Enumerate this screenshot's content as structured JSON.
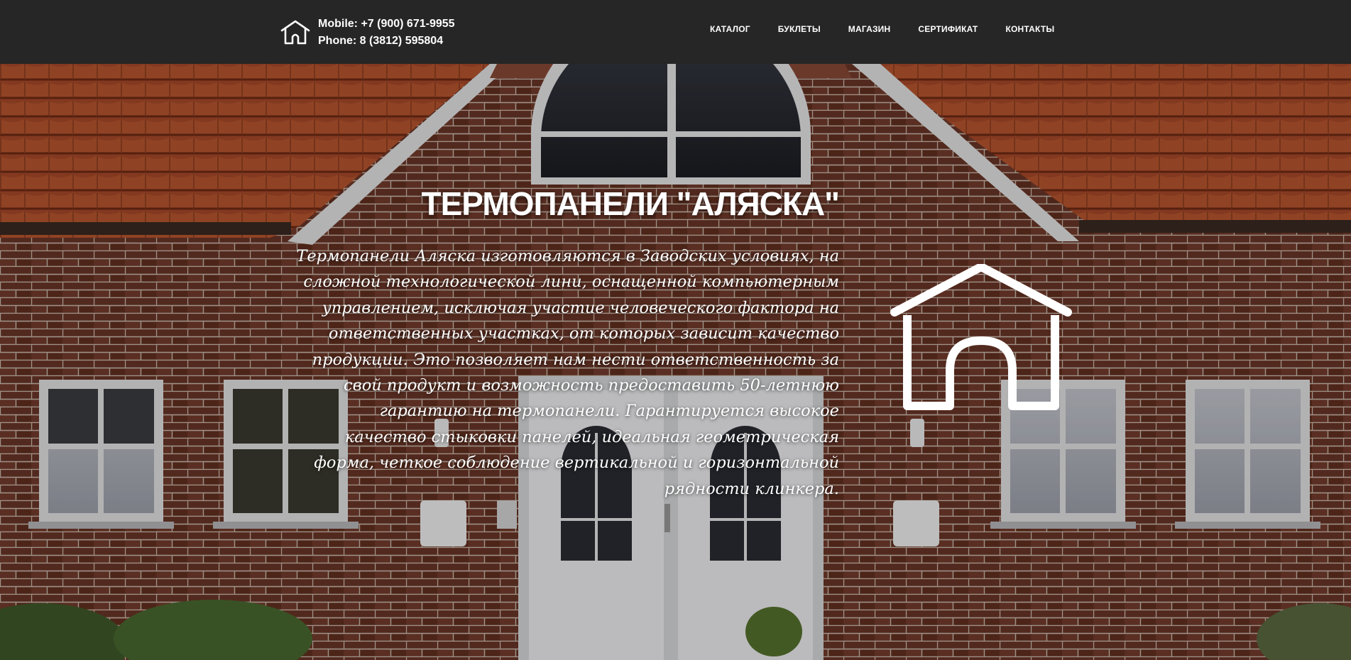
{
  "header": {
    "logo_icon": "house-outline-icon",
    "mobile": "Mobile: +7 (900) 671-9955",
    "phone": "Phone: 8 (3812) 595804"
  },
  "nav": {
    "items": [
      {
        "label": "КАТАЛОГ"
      },
      {
        "label": "БУКЛЕТЫ"
      },
      {
        "label": "МАГАЗИН"
      },
      {
        "label": "СЕРТИФИКАТ"
      },
      {
        "label": "КОНТАКТЫ"
      }
    ]
  },
  "hero": {
    "title": "ТЕРМОПАНЕЛИ \"АЛЯСКА\"",
    "description": "Термопанели Аляска изготовляются в Заводских условиях, на сложной технологической лини, оснащенной компьютерным управлением, исключая участие человеческого фактора на ответственных участках, от которых зависит качество продукции. Это позволяет нам нести ответственность за свой продукт и возможность предоставить 50-летнюю гарантию на термопанели. Гарантируется высокое качество стыковки панелей, идеальная геометрическая форма, четкое соблюдение вертикальной и горизонтальной рядности клинкера.",
    "house_icon": "house-outline-icon",
    "background": "brick-house-photo"
  },
  "colors": {
    "header_bg": "#262626",
    "text": "#ffffff",
    "brick": "#6e3a2c",
    "roof": "#b5532d"
  }
}
